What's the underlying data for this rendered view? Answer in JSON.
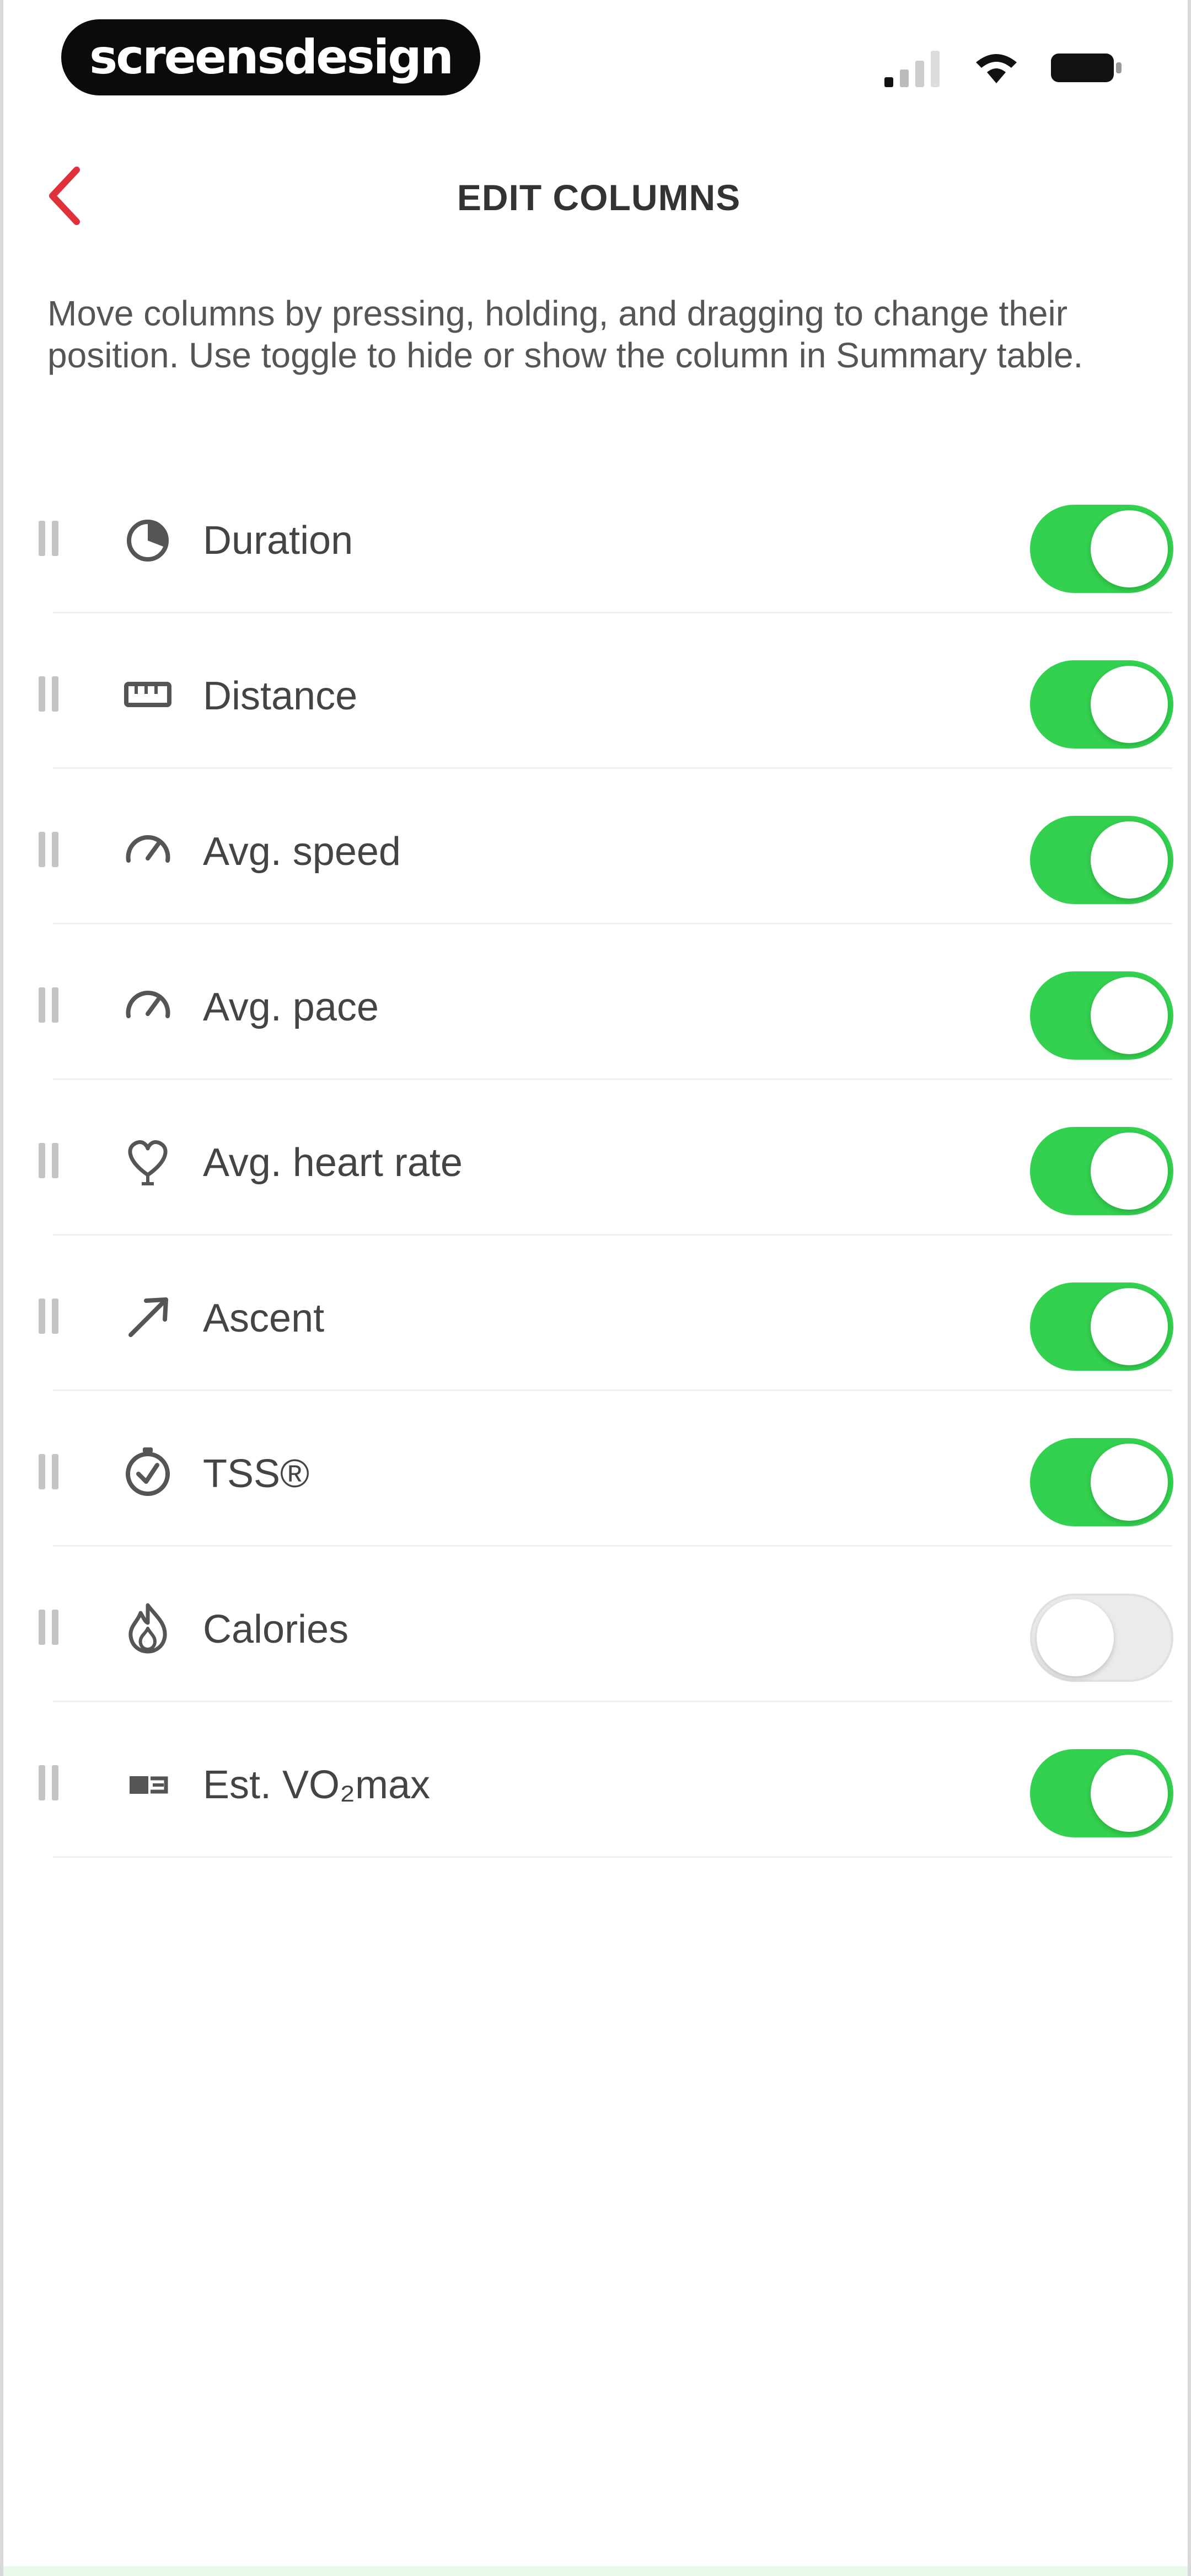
{
  "status_bar": {
    "brand_text": "screensdesign",
    "icons": [
      "cellular-signal-icon",
      "wifi-icon",
      "battery-icon"
    ]
  },
  "header": {
    "back_icon": "chevron-left-icon",
    "title": "EDIT COLUMNS"
  },
  "description": "Move columns by pressing, holding, and dragging to change their position. Use toggle to hide or show the column in Summary table.",
  "colors": {
    "accent": "#e0303a",
    "toggle_on": "#33d14f",
    "toggle_off": "#ebebeb"
  },
  "columns": [
    {
      "label": "Duration",
      "icon": "stopwatch-icon",
      "enabled": true
    },
    {
      "label": "Distance",
      "icon": "ruler-icon",
      "enabled": true
    },
    {
      "label": "Avg. speed",
      "icon": "speedometer-icon",
      "enabled": true
    },
    {
      "label": "Avg. pace",
      "icon": "speedometer-icon",
      "enabled": true
    },
    {
      "label": "Avg. heart rate",
      "icon": "heart-icon",
      "enabled": true
    },
    {
      "label": "Ascent",
      "icon": "arrow-up-right-icon",
      "enabled": true
    },
    {
      "label": "TSS®",
      "icon": "training-load-icon",
      "enabled": true
    },
    {
      "label": "Calories",
      "icon": "flame-icon",
      "enabled": false
    },
    {
      "label": "Est. VO₂max",
      "icon": "vo2max-icon",
      "enabled": true
    }
  ]
}
